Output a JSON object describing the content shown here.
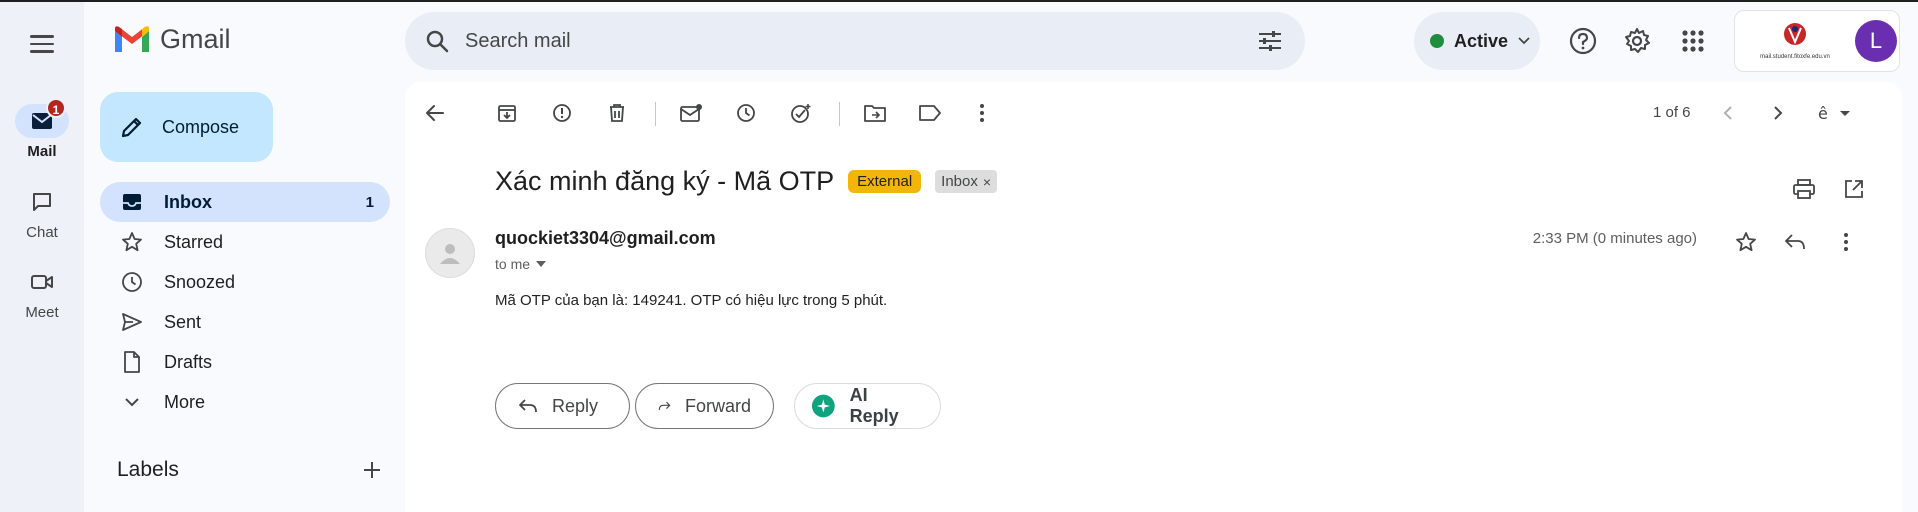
{
  "app": {
    "name": "Gmail"
  },
  "rail": {
    "items": [
      {
        "label": "Mail",
        "badge": "1",
        "active": true
      },
      {
        "label": "Chat"
      },
      {
        "label": "Meet"
      }
    ]
  },
  "search": {
    "placeholder": "Search mail"
  },
  "status": {
    "label": "Active",
    "color": "#1e8e3e"
  },
  "account": {
    "org_text": "mail.student.fitoxfe.edu.vn",
    "avatar_letter": "L",
    "avatar_color": "#6a2fb0"
  },
  "compose": {
    "label": "Compose"
  },
  "nav": [
    {
      "label": "Inbox",
      "count": "1",
      "active": true
    },
    {
      "label": "Starred"
    },
    {
      "label": "Snoozed"
    },
    {
      "label": "Sent"
    },
    {
      "label": "Drafts"
    },
    {
      "label": "More"
    }
  ],
  "labels": {
    "title": "Labels"
  },
  "toolbar": {
    "pager": "1 of 6"
  },
  "email": {
    "subject": "Xác minh đăng ký - Mã OTP",
    "tag_external": "External",
    "tag_inbox": "Inbox",
    "tag_close": "×",
    "sender": "quockiet3304@gmail.com",
    "to": "to me",
    "time": "2:33 PM (0 minutes ago)",
    "body": "Mã OTP của bạn là: 149241. OTP có hiệu lực trong 5 phút."
  },
  "actions": {
    "reply": "Reply",
    "forward": "Forward",
    "ai_reply": "AI Reply"
  },
  "colors": {
    "accent": "#0b57d0",
    "nav_active": "#d3e3fd",
    "compose": "#c2e7ff",
    "external_tag": "#f2b50a",
    "badge": "#b3261e"
  }
}
